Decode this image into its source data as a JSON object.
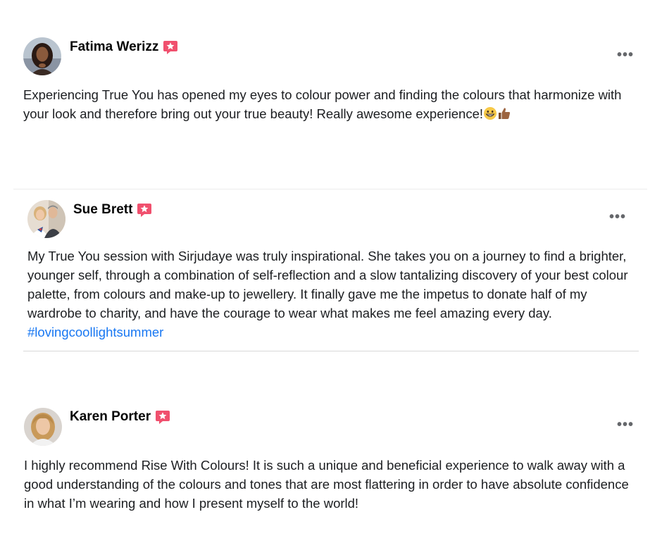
{
  "reviews": [
    {
      "name": "Fatima Werizz",
      "avatar_icon": "person-avatar",
      "badge_icon": "recommend-star-badge",
      "badge_color": "#f0506e",
      "more_label": "•••",
      "text": "Experiencing True You has opened my eyes to colour power and finding the colours that harmonize with your look and therefore bring out your true beauty! Really awesome experience!",
      "emojis": [
        "grinning-face-emoji",
        "thumbs-up-emoji"
      ]
    },
    {
      "name": "Sue Brett",
      "avatar_icon": "couple-avatar",
      "badge_icon": "recommend-star-badge",
      "badge_color": "#f0506e",
      "more_label": "•••",
      "text": "My True You session with Sirjudaye was truly inspirational. She takes you on a journey to find a brighter, younger self, through a combination of self-reflection and a slow tantalizing discovery of your best colour palette, from colours and make-up to jewellery. It finally gave me the impetus to donate half of my wardrobe to charity, and have the courage to wear what makes me feel amazing every day.",
      "hashtag": "#lovingcoollightsummer",
      "hashtag_color": "#1877f2"
    },
    {
      "name": "Karen Porter",
      "avatar_icon": "person-avatar",
      "badge_icon": "recommend-star-badge",
      "badge_color": "#f0506e",
      "more_label": "•••",
      "text": "I highly recommend Rise With Colours!  It is such a unique and beneficial experience to walk away with a good understanding of the colours and tones that are most flattering in order to have absolute confidence in what I’m wearing and how I present myself to the world!"
    }
  ]
}
